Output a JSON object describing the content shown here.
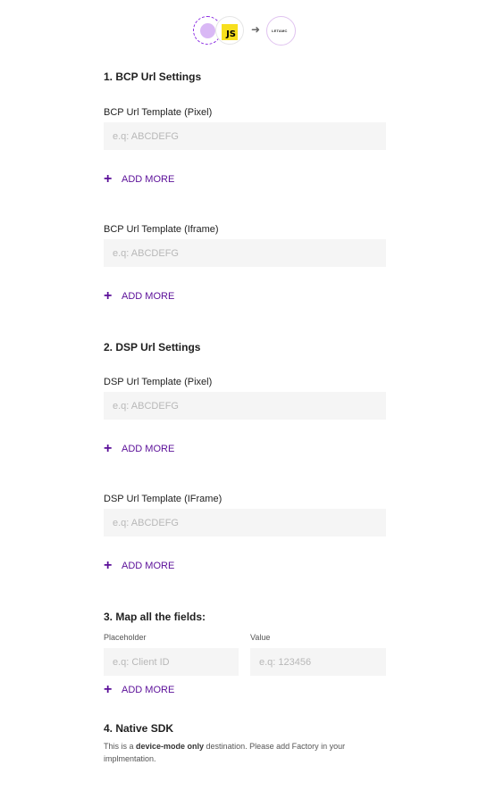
{
  "header": {
    "source_icon": "source-dot-icon",
    "js_badge": "JS",
    "arrow": "➜",
    "destination_logo": "LETAMC"
  },
  "sections": {
    "bcp": {
      "title": "1. BCP Url Settings",
      "pixel": {
        "label": "BCP Url Template (Pixel)",
        "placeholder": "e.q: ABCDEFG",
        "value": "",
        "add_more": "ADD MORE"
      },
      "iframe": {
        "label": "BCP Url Template (Iframe)",
        "placeholder": "e.q: ABCDEFG",
        "value": "",
        "add_more": "ADD MORE"
      }
    },
    "dsp": {
      "title": "2. DSP Url Settings",
      "pixel": {
        "label": "DSP Url Template (Pixel)",
        "placeholder": "e.q: ABCDEFG",
        "value": "",
        "add_more": "ADD MORE"
      },
      "iframe": {
        "label": "DSP Url Template (IFrame)",
        "placeholder": "e.q: ABCDEFG",
        "value": "",
        "add_more": "ADD MORE"
      }
    },
    "map": {
      "title": "3. Map all the fields:",
      "placeholder_label": "Placeholder",
      "value_label": "Value",
      "placeholder_input_placeholder": "e.q: Client ID",
      "value_input_placeholder": "e.q: 123456",
      "add_more": "ADD MORE"
    },
    "native": {
      "title": "4. Native SDK",
      "desc_prefix": "This is a ",
      "desc_bold": "device-mode only",
      "desc_suffix": " destination. Please add Factory in your implmentation."
    }
  },
  "colors": {
    "accent": "#5b0f99",
    "input_bg": "#f5f5f5",
    "js_yellow": "#f7df1e"
  }
}
